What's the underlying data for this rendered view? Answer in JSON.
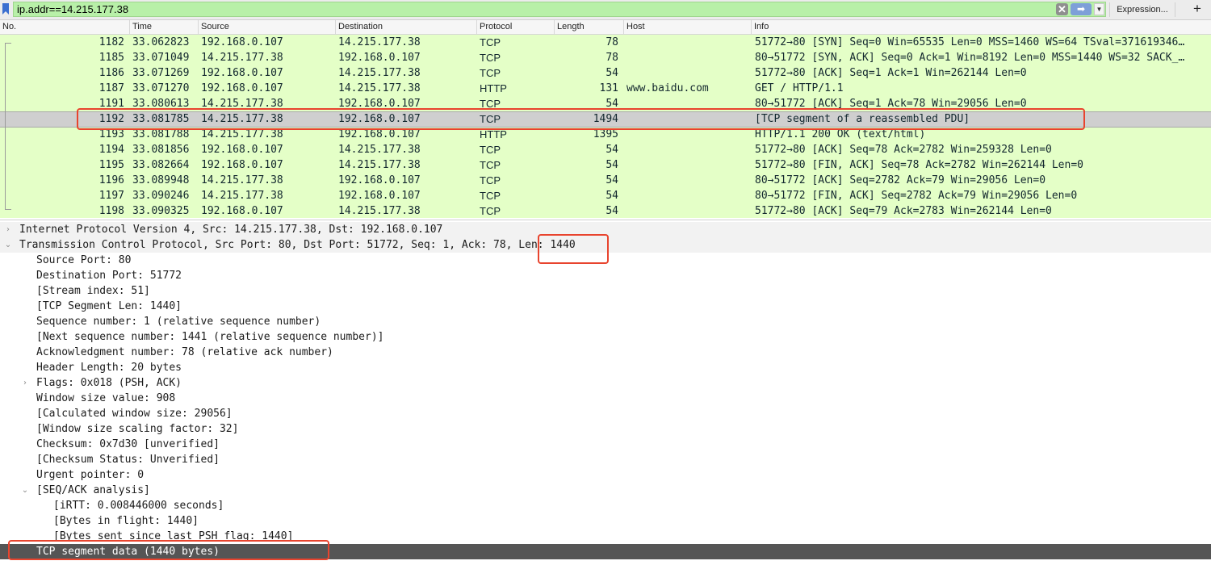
{
  "filter": {
    "value": "ip.addr==14.215.177.38",
    "clear_icon": "clear-icon",
    "apply_icon": "arrow-right-icon",
    "dropdown_icon": "chevron-down-icon",
    "expression_label": "Expression...",
    "add_label": "+"
  },
  "columns": {
    "no": "No.",
    "time": "Time",
    "source": "Source",
    "destination": "Destination",
    "protocol": "Protocol",
    "length": "Length",
    "host": "Host",
    "info": "Info"
  },
  "packets": [
    {
      "no": "1182",
      "time": "33.062823",
      "src": "192.168.0.107",
      "dst": "14.215.177.38",
      "proto": "TCP",
      "len": "78",
      "host": "",
      "info": "51772→80 [SYN] Seq=0 Win=65535 Len=0 MSS=1460 WS=64 TSval=371619346…"
    },
    {
      "no": "1185",
      "time": "33.071049",
      "src": "14.215.177.38",
      "dst": "192.168.0.107",
      "proto": "TCP",
      "len": "78",
      "host": "",
      "info": "80→51772 [SYN, ACK] Seq=0 Ack=1 Win=8192 Len=0 MSS=1440 WS=32 SACK_…"
    },
    {
      "no": "1186",
      "time": "33.071269",
      "src": "192.168.0.107",
      "dst": "14.215.177.38",
      "proto": "TCP",
      "len": "54",
      "host": "",
      "info": "51772→80 [ACK] Seq=1 Ack=1 Win=262144 Len=0"
    },
    {
      "no": "1187",
      "time": "33.071270",
      "src": "192.168.0.107",
      "dst": "14.215.177.38",
      "proto": "HTTP",
      "len": "131",
      "host": "www.baidu.com",
      "info": "GET / HTTP/1.1"
    },
    {
      "no": "1191",
      "time": "33.080613",
      "src": "14.215.177.38",
      "dst": "192.168.0.107",
      "proto": "TCP",
      "len": "54",
      "host": "",
      "info": "80→51772 [ACK] Seq=1 Ack=78 Win=29056 Len=0"
    },
    {
      "no": "1192",
      "time": "33.081785",
      "src": "14.215.177.38",
      "dst": "192.168.0.107",
      "proto": "TCP",
      "len": "1494",
      "host": "",
      "info": "[TCP segment of a reassembled PDU]"
    },
    {
      "no": "1193",
      "time": "33.081788",
      "src": "14.215.177.38",
      "dst": "192.168.0.107",
      "proto": "HTTP",
      "len": "1395",
      "host": "",
      "info": "HTTP/1.1 200 OK  (text/html)"
    },
    {
      "no": "1194",
      "time": "33.081856",
      "src": "192.168.0.107",
      "dst": "14.215.177.38",
      "proto": "TCP",
      "len": "54",
      "host": "",
      "info": "51772→80 [ACK] Seq=78 Ack=2782 Win=259328 Len=0"
    },
    {
      "no": "1195",
      "time": "33.082664",
      "src": "192.168.0.107",
      "dst": "14.215.177.38",
      "proto": "TCP",
      "len": "54",
      "host": "",
      "info": "51772→80 [FIN, ACK] Seq=78 Ack=2782 Win=262144 Len=0"
    },
    {
      "no": "1196",
      "time": "33.089948",
      "src": "14.215.177.38",
      "dst": "192.168.0.107",
      "proto": "TCP",
      "len": "54",
      "host": "",
      "info": "80→51772 [ACK] Seq=2782 Ack=79 Win=29056 Len=0"
    },
    {
      "no": "1197",
      "time": "33.090246",
      "src": "14.215.177.38",
      "dst": "192.168.0.107",
      "proto": "TCP",
      "len": "54",
      "host": "",
      "info": "80→51772 [FIN, ACK] Seq=2782 Ack=79 Win=29056 Len=0"
    },
    {
      "no": "1198",
      "time": "33.090325",
      "src": "192.168.0.107",
      "dst": "14.215.177.38",
      "proto": "TCP",
      "len": "54",
      "host": "",
      "info": "51772→80 [ACK] Seq=79 Ack=2783 Win=262144 Len=0"
    }
  ],
  "details": {
    "ip_summary": "Internet Protocol Version 4, Src: 14.215.177.38, Dst: 192.168.0.107",
    "tcp_summary": "Transmission Control Protocol, Src Port: 80, Dst Port: 51772, Seq: 1, Ack: 78, Len: 1440",
    "fields": [
      "Source Port: 80",
      "Destination Port: 51772",
      "[Stream index: 51]",
      "[TCP Segment Len: 1440]",
      "Sequence number: 1    (relative sequence number)",
      "[Next sequence number: 1441    (relative sequence number)]",
      "Acknowledgment number: 78    (relative ack number)",
      "Header Length: 20 bytes",
      "Flags: 0x018 (PSH, ACK)",
      "Window size value: 908",
      "[Calculated window size: 29056]",
      "[Window size scaling factor: 32]",
      "Checksum: 0x7d30 [unverified]",
      "[Checksum Status: Unverified]",
      "Urgent pointer: 0",
      "[SEQ/ACK analysis]"
    ],
    "seqack": [
      "[iRTT: 0.008446000 seconds]",
      "[Bytes in flight: 1440]",
      "[Bytes sent since last PSH flag: 1440]"
    ],
    "segment_data": "TCP segment data (1440 bytes)"
  },
  "colors": {
    "filter_bg": "#b8f0a8",
    "row_bg": "#e4ffc7",
    "selected_bg": "#cfcfcf",
    "annotation": "#e8442e"
  }
}
